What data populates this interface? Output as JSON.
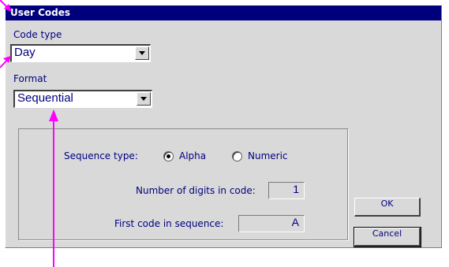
{
  "dialog": {
    "title": "User Codes",
    "code_type": {
      "label": "Code type",
      "value": "Day"
    },
    "format": {
      "label": "Format",
      "value": "Sequential"
    },
    "sequence": {
      "label": "Sequence type:",
      "options": [
        {
          "label": "Alpha",
          "selected": true
        },
        {
          "label": "Numeric",
          "selected": false
        }
      ]
    },
    "digits": {
      "label": "Number of digits in code:",
      "value": "1"
    },
    "first_code": {
      "label": "First code in sequence:",
      "value": "A"
    },
    "buttons": {
      "ok": "OK",
      "cancel": "Cancel"
    }
  },
  "colors": {
    "title_bar": "#00007c",
    "text": "#000080",
    "annotation": "#ff00ff"
  }
}
